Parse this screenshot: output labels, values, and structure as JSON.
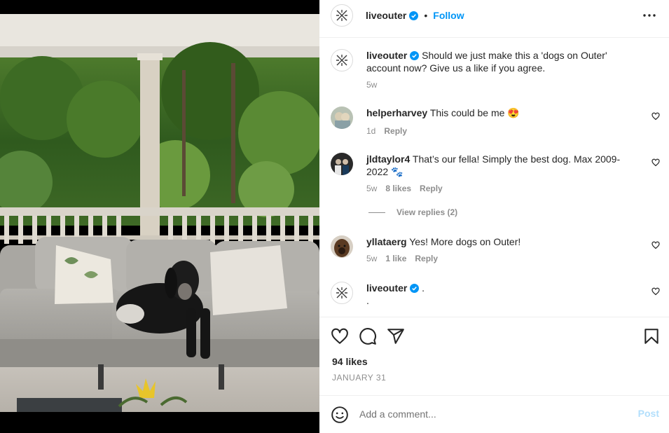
{
  "post": {
    "username": "liveouter",
    "follow_label": "Follow",
    "separator": "•",
    "caption": {
      "username": "liveouter",
      "text": "Should we just make this a 'dogs on Outer' account now? Give us a like if you agree.",
      "time": "5w"
    },
    "likes": "94 likes",
    "date": "JANUARY 31"
  },
  "comments": [
    {
      "username": "helperharvey",
      "text": "This could be me 😍",
      "time": "1d",
      "likes": "",
      "reply": "Reply"
    },
    {
      "username": "jldtaylor4",
      "text": "That’s our fella! Simply the best dog. Max 2009-2022 🐾",
      "time": "5w",
      "likes": "8 likes",
      "reply": "Reply"
    },
    {
      "username": "yllataerg",
      "text": "Yes! More dogs on Outer!",
      "time": "5w",
      "likes": "1 like",
      "reply": "Reply"
    },
    {
      "username": "liveouter",
      "text": ".",
      "text2": "."
    }
  ],
  "view_replies": "View replies (2)",
  "add_comment": {
    "placeholder": "Add a comment...",
    "post_label": "Post"
  },
  "colors": {
    "accent": "#0095f6",
    "verified": "#0095f6",
    "muted": "#8e8e8e",
    "post_disabled": "#b2dffc"
  },
  "icons": [
    "more-icon",
    "verified-icon",
    "heart-icon",
    "comment-icon",
    "share-icon",
    "bookmark-icon",
    "emoji-icon",
    "outer-logo-icon"
  ]
}
